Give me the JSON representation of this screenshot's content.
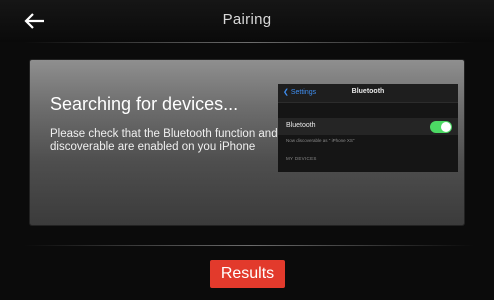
{
  "header": {
    "title": "Pairing",
    "back_icon": "back-arrow-icon"
  },
  "panel": {
    "heading": "Searching for devices...",
    "description": "Please check that the Bluetooth function and discoverable are enabled on you iPhone"
  },
  "phone_preview": {
    "back_label": "Settings",
    "title": "Bluetooth",
    "row_label": "Bluetooth",
    "toggle_on": true,
    "toggle_color": "#4cd964",
    "discoverable_note": "Now discoverable as \" iPhone XS\"",
    "section_header": "MY DEVICES"
  },
  "footer": {
    "results_label": "Results",
    "results_color": "#e23a2c"
  }
}
